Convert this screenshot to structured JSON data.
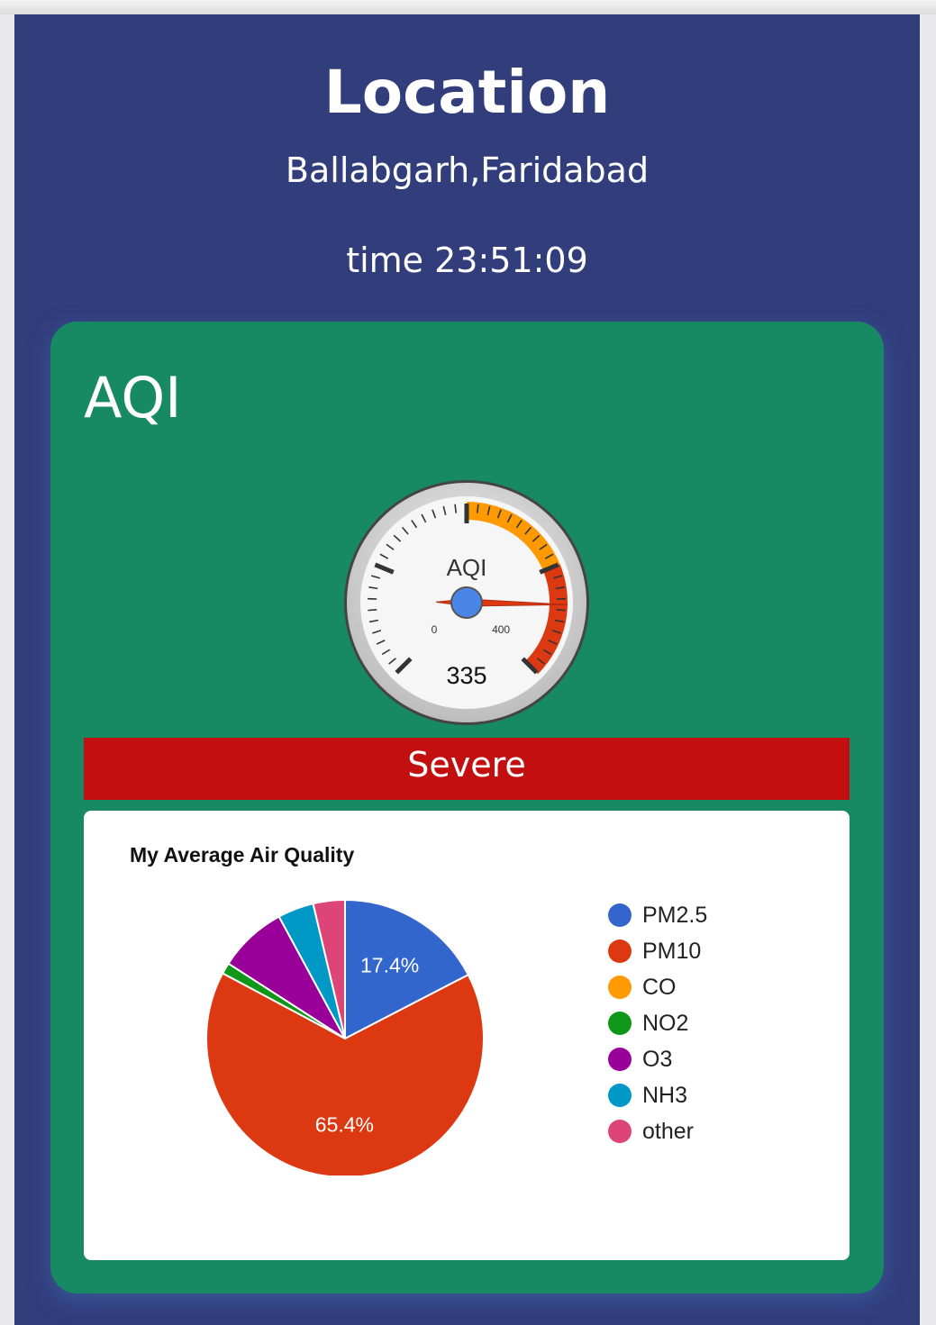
{
  "location": {
    "title": "Location",
    "name": "Ballabgarh,Faridabad",
    "time": "time 23:51:09"
  },
  "aqi_card": {
    "title": "AQI",
    "gauge": {
      "label": "AQI",
      "value": 335,
      "value_text": "335",
      "min": 0,
      "max": 400,
      "min_label": "0",
      "max_label": "400",
      "bands": [
        {
          "from": 200,
          "to": 300,
          "color": "#ff9900"
        },
        {
          "from": 300,
          "to": 400,
          "color": "#dc3912"
        }
      ]
    },
    "status": {
      "label": "Severe",
      "color": "#c30f10"
    }
  },
  "chart_data": {
    "type": "pie",
    "title": "My Average Air Quality",
    "categories": [
      "PM2.5",
      "PM10",
      "CO",
      "NO2",
      "O3",
      "NH3",
      "other"
    ],
    "values": [
      17.4,
      65.4,
      0,
      1.3,
      8.0,
      4.2,
      3.7
    ],
    "slice_labels": [
      "17.4%",
      "65.4%",
      "",
      "",
      "",
      "",
      ""
    ],
    "colors": [
      "#3366cc",
      "#dc3912",
      "#ff9900",
      "#109618",
      "#990099",
      "#0099c6",
      "#dd4477"
    ],
    "legend_position": "right"
  }
}
